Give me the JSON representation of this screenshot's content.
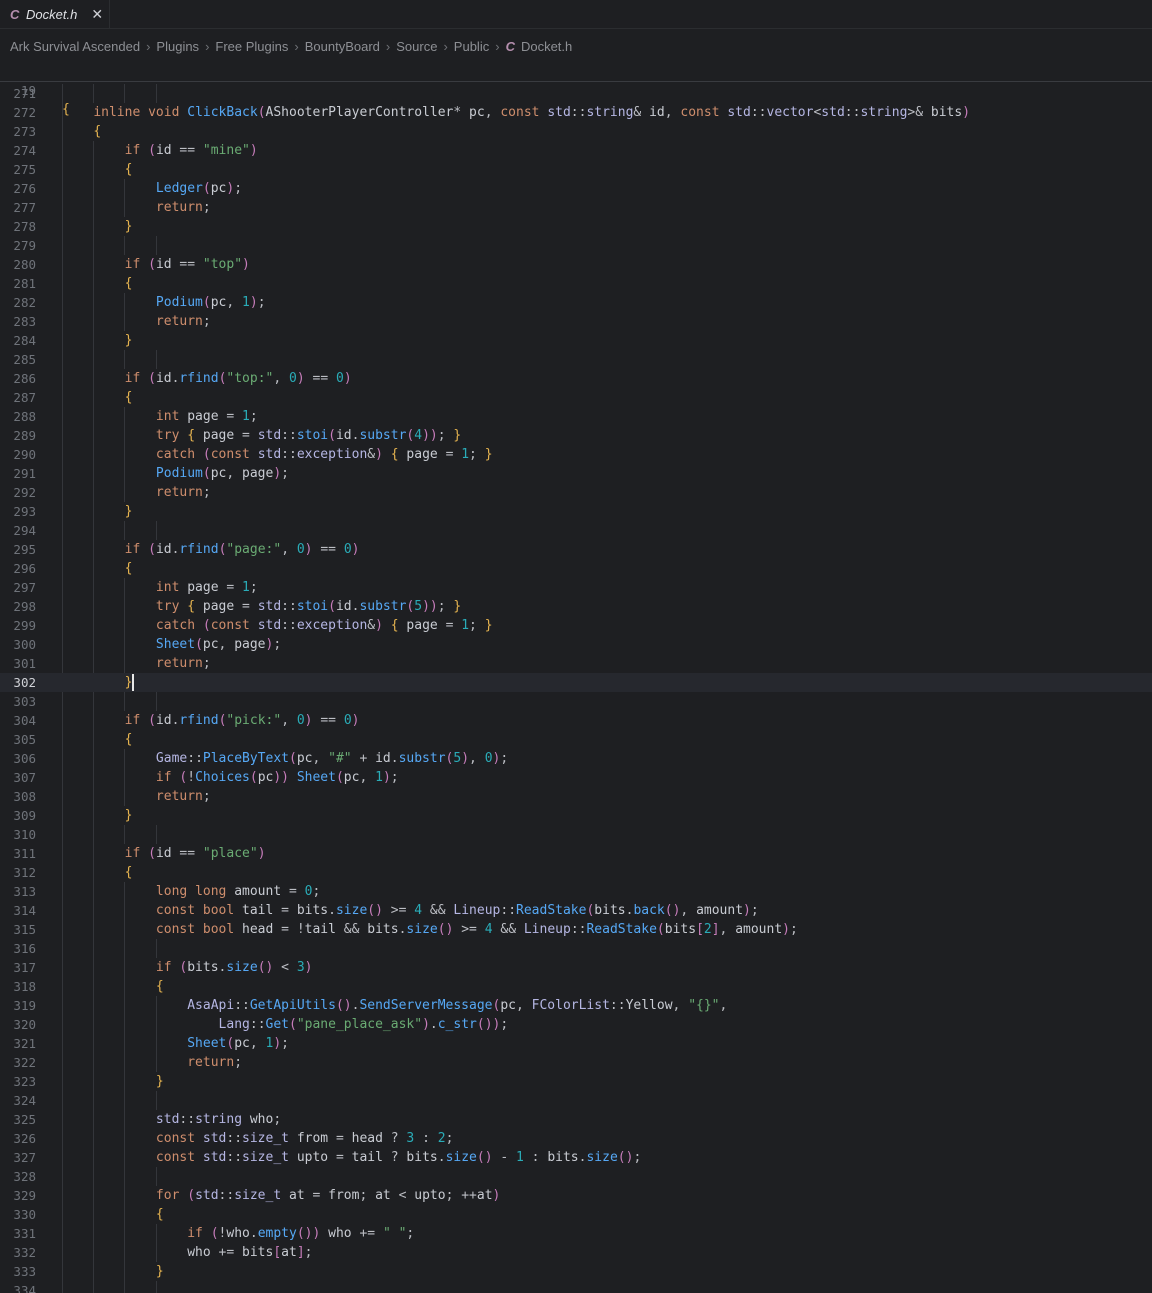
{
  "tab": {
    "icon": "c-file-icon",
    "icon_glyph": "C",
    "title": "Docket.h",
    "close_glyph": "✕"
  },
  "breadcrumb": {
    "items": [
      "Ark Survival Ascended",
      "Plugins",
      "Free Plugins",
      "BountyBoard",
      "Source",
      "Public"
    ],
    "file_icon_glyph": "C",
    "file": "Docket.h",
    "separator": "›"
  },
  "editor": {
    "sticky_line": {
      "number": "19",
      "text": "{"
    },
    "current_line": "302",
    "lines": [
      {
        "n": "271",
        "t": ""
      },
      {
        "n": "272",
        "t": "    inline void ClickBack(AShooterPlayerController* pc, const std::string& id, const std::vector<std::string>& bits)"
      },
      {
        "n": "273",
        "t": "    {"
      },
      {
        "n": "274",
        "t": "        if (id == \"mine\")"
      },
      {
        "n": "275",
        "t": "        {"
      },
      {
        "n": "276",
        "t": "            Ledger(pc);"
      },
      {
        "n": "277",
        "t": "            return;"
      },
      {
        "n": "278",
        "t": "        }"
      },
      {
        "n": "279",
        "t": ""
      },
      {
        "n": "280",
        "t": "        if (id == \"top\")"
      },
      {
        "n": "281",
        "t": "        {"
      },
      {
        "n": "282",
        "t": "            Podium(pc, 1);"
      },
      {
        "n": "283",
        "t": "            return;"
      },
      {
        "n": "284",
        "t": "        }"
      },
      {
        "n": "285",
        "t": ""
      },
      {
        "n": "286",
        "t": "        if (id.rfind(\"top:\", 0) == 0)"
      },
      {
        "n": "287",
        "t": "        {"
      },
      {
        "n": "288",
        "t": "            int page = 1;"
      },
      {
        "n": "289",
        "t": "            try { page = std::stoi(id.substr(4)); }"
      },
      {
        "n": "290",
        "t": "            catch (const std::exception&) { page = 1; }"
      },
      {
        "n": "291",
        "t": "            Podium(pc, page);"
      },
      {
        "n": "292",
        "t": "            return;"
      },
      {
        "n": "293",
        "t": "        }"
      },
      {
        "n": "294",
        "t": ""
      },
      {
        "n": "295",
        "t": "        if (id.rfind(\"page:\", 0) == 0)"
      },
      {
        "n": "296",
        "t": "        {"
      },
      {
        "n": "297",
        "t": "            int page = 1;"
      },
      {
        "n": "298",
        "t": "            try { page = std::stoi(id.substr(5)); }"
      },
      {
        "n": "299",
        "t": "            catch (const std::exception&) { page = 1; }"
      },
      {
        "n": "300",
        "t": "            Sheet(pc, page);"
      },
      {
        "n": "301",
        "t": "            return;"
      },
      {
        "n": "302",
        "t": "        }"
      },
      {
        "n": "303",
        "t": ""
      },
      {
        "n": "304",
        "t": "        if (id.rfind(\"pick:\", 0) == 0)"
      },
      {
        "n": "305",
        "t": "        {"
      },
      {
        "n": "306",
        "t": "            Game::PlaceByText(pc, \"#\" + id.substr(5), 0);"
      },
      {
        "n": "307",
        "t": "            if (!Choices(pc)) Sheet(pc, 1);"
      },
      {
        "n": "308",
        "t": "            return;"
      },
      {
        "n": "309",
        "t": "        }"
      },
      {
        "n": "310",
        "t": ""
      },
      {
        "n": "311",
        "t": "        if (id == \"place\")"
      },
      {
        "n": "312",
        "t": "        {"
      },
      {
        "n": "313",
        "t": "            long long amount = 0;"
      },
      {
        "n": "314",
        "t": "            const bool tail = bits.size() >= 4 && Lineup::ReadStake(bits.back(), amount);"
      },
      {
        "n": "315",
        "t": "            const bool head = !tail && bits.size() >= 4 && Lineup::ReadStake(bits[2], amount);"
      },
      {
        "n": "316",
        "t": ""
      },
      {
        "n": "317",
        "t": "            if (bits.size() < 3)"
      },
      {
        "n": "318",
        "t": "            {"
      },
      {
        "n": "319",
        "t": "                AsaApi::GetApiUtils().SendServerMessage(pc, FColorList::Yellow, \"{}\","
      },
      {
        "n": "320",
        "t": "                    Lang::Get(\"pane_place_ask\").c_str());"
      },
      {
        "n": "321",
        "t": "                Sheet(pc, 1);"
      },
      {
        "n": "322",
        "t": "                return;"
      },
      {
        "n": "323",
        "t": "            }"
      },
      {
        "n": "324",
        "t": ""
      },
      {
        "n": "325",
        "t": "            std::string who;"
      },
      {
        "n": "326",
        "t": "            const std::size_t from = head ? 3 : 2;"
      },
      {
        "n": "327",
        "t": "            const std::size_t upto = tail ? bits.size() - 1 : bits.size();"
      },
      {
        "n": "328",
        "t": ""
      },
      {
        "n": "329",
        "t": "            for (std::size_t at = from; at < upto; ++at)"
      },
      {
        "n": "330",
        "t": "            {"
      },
      {
        "n": "331",
        "t": "                if (!who.empty()) who += \" \";"
      },
      {
        "n": "332",
        "t": "                who += bits[at];"
      },
      {
        "n": "333",
        "t": "            }"
      },
      {
        "n": "334",
        "t": ""
      }
    ]
  }
}
